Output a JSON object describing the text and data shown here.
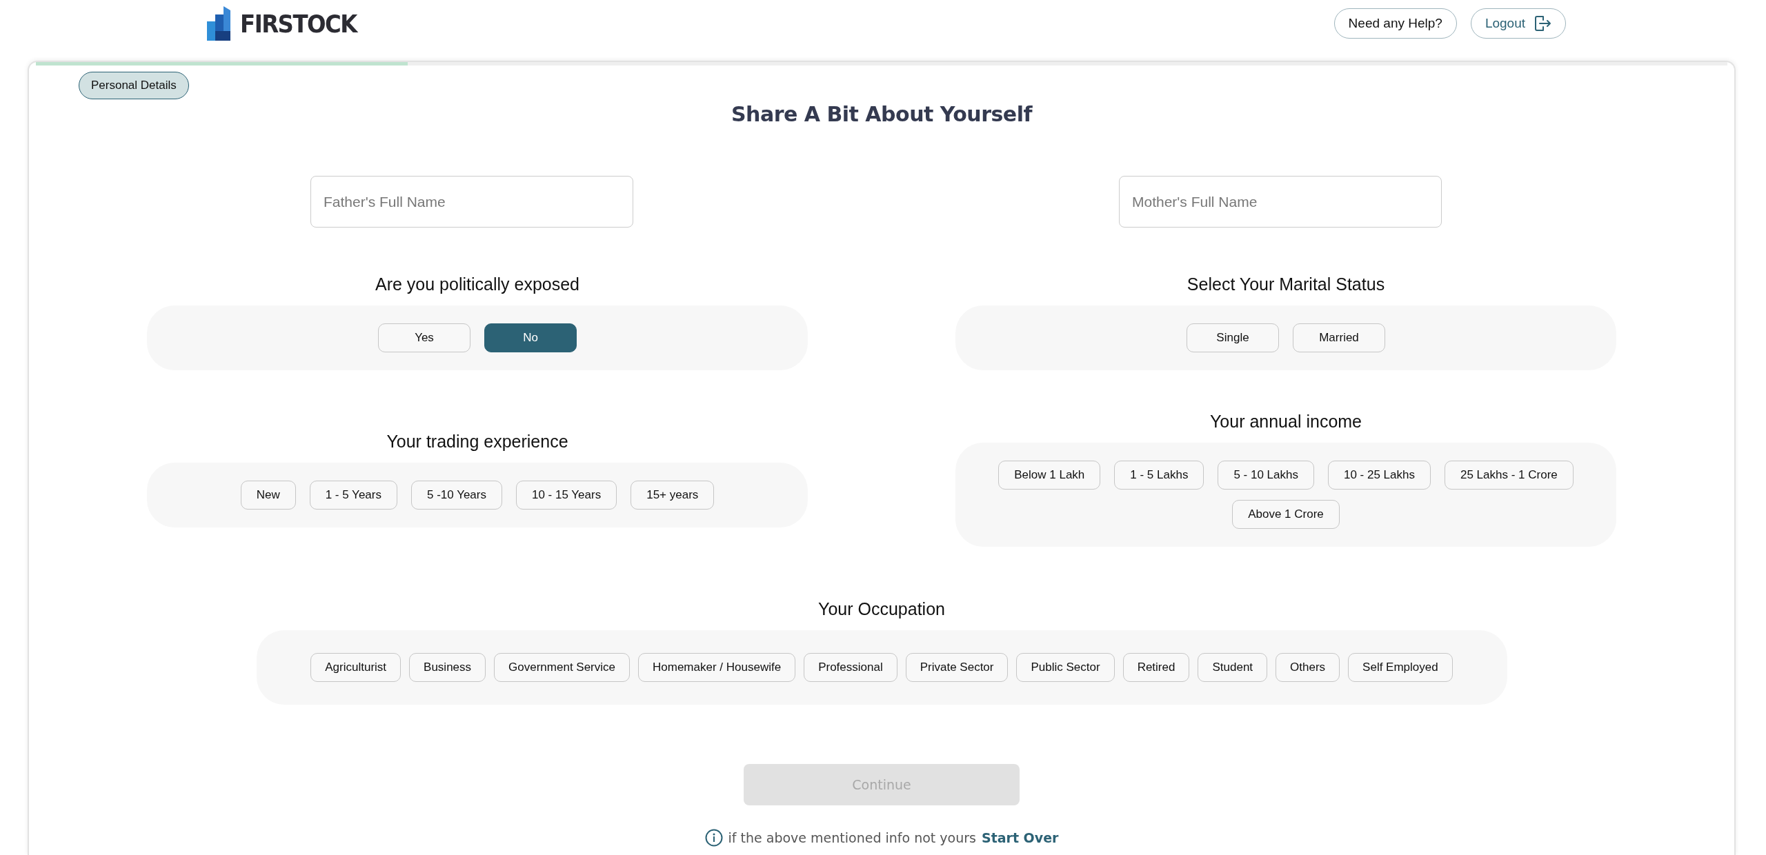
{
  "header": {
    "logo_text": "FIRSTOCK",
    "help_button": "Need any Help?",
    "logout_button": "Logout"
  },
  "progress": {
    "level": 0.22
  },
  "step_badge": "Personal Details",
  "title": "Share A Bit About Yourself",
  "fields": [
    {
      "placeholder": "Father's Full Name"
    },
    {
      "placeholder": "Mother's Full Name"
    }
  ],
  "questions": [
    {
      "label": "Are you politically exposed",
      "options": [
        {
          "label": "Yes",
          "selected": false
        },
        {
          "label": "No",
          "selected": true
        }
      ]
    },
    {
      "label": "Your trading experience",
      "options": [
        {
          "label": "New",
          "selected": false
        },
        {
          "label": "1 - 5 Years",
          "selected": false
        },
        {
          "label": "5 -10 Years",
          "selected": false
        },
        {
          "label": "10 - 15 Years",
          "selected": false
        },
        {
          "label": "15+ years",
          "selected": false
        }
      ]
    },
    {
      "label": "Select Your Marital Status",
      "options": [
        {
          "label": "Single",
          "selected": false
        },
        {
          "label": "Married",
          "selected": false
        }
      ]
    },
    {
      "label": "Your annual income",
      "options": [
        {
          "label": "Below 1 Lakh",
          "selected": false
        },
        {
          "label": "1 - 5 Lakhs",
          "selected": false
        },
        {
          "label": "5 - 10 Lakhs",
          "selected": false
        },
        {
          "label": "10 - 25 Lakhs",
          "selected": false
        },
        {
          "label": "25 Lakhs - 1 Crore",
          "selected": false
        },
        {
          "label": "Above 1 Crore",
          "selected": false
        }
      ]
    }
  ],
  "occupation": {
    "label": "Your Occupation",
    "options": [
      {
        "label": "Agriculturist",
        "selected": false
      },
      {
        "label": "Business",
        "selected": false
      },
      {
        "label": "Government Service",
        "selected": false
      },
      {
        "label": "Homemaker / Housewife",
        "selected": false
      },
      {
        "label": "Professional",
        "selected": false
      },
      {
        "label": "Private Sector",
        "selected": false
      },
      {
        "label": "Public Sector",
        "selected": false
      },
      {
        "label": "Retired",
        "selected": false
      },
      {
        "label": "Student",
        "selected": false
      },
      {
        "label": "Others",
        "selected": false
      },
      {
        "label": "Self Employed",
        "selected": false
      }
    ]
  },
  "continue_button": {
    "label": "Continue",
    "disabled": true
  },
  "footer_note": {
    "text": "if the above mentioned info not yours",
    "link": "Start Over"
  }
}
